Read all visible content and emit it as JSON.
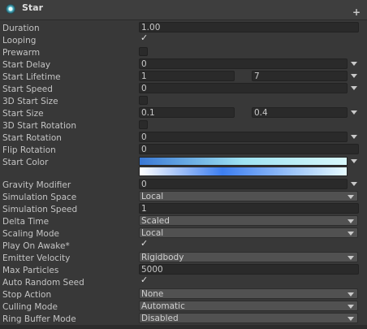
{
  "header": {
    "title": "Star",
    "icon": "particle-system-icon",
    "add_icon": "plus-icon",
    "add_label": "+"
  },
  "fields": {
    "duration": {
      "label": "Duration",
      "value": "1.00"
    },
    "looping": {
      "label": "Looping",
      "checked": true,
      "mark": "✓"
    },
    "prewarm": {
      "label": "Prewarm",
      "checked": false
    },
    "start_delay": {
      "label": "Start Delay",
      "value": "0"
    },
    "start_lifetime": {
      "label": "Start Lifetime",
      "min": "1",
      "max": "7"
    },
    "start_speed": {
      "label": "Start Speed",
      "value": "0"
    },
    "start_size_3d": {
      "label": "3D Start Size",
      "checked": false
    },
    "start_size": {
      "label": "Start Size",
      "min": "0.1",
      "max": "0.4"
    },
    "start_rotation_3d": {
      "label": "3D Start Rotation",
      "checked": false
    },
    "start_rotation": {
      "label": "Start Rotation",
      "value": "0"
    },
    "flip_rotation": {
      "label": "Flip Rotation",
      "value": "0"
    },
    "start_color": {
      "label": "Start Color",
      "gradient_top": [
        "#3a79d6",
        "#9fe3f2",
        "#d8f8fb"
      ],
      "gradient_bottom": [
        "#ffffff",
        "#3d7ef0",
        "#e6fbff"
      ]
    },
    "gravity_modifier": {
      "label": "Gravity Modifier",
      "value": "0"
    },
    "simulation_space": {
      "label": "Simulation Space",
      "value": "Local"
    },
    "simulation_speed": {
      "label": "Simulation Speed",
      "value": "1"
    },
    "delta_time": {
      "label": "Delta Time",
      "value": "Scaled"
    },
    "scaling_mode": {
      "label": "Scaling Mode",
      "value": "Local"
    },
    "play_on_awake": {
      "label": "Play On Awake*",
      "checked": true,
      "mark": "✓"
    },
    "emitter_velocity": {
      "label": "Emitter Velocity",
      "value": "Rigidbody"
    },
    "max_particles": {
      "label": "Max Particles",
      "value": "5000"
    },
    "auto_random_seed": {
      "label": "Auto Random Seed",
      "checked": true,
      "mark": "✓"
    },
    "stop_action": {
      "label": "Stop Action",
      "value": "None"
    },
    "culling_mode": {
      "label": "Culling Mode",
      "value": "Automatic"
    },
    "ring_buffer_mode": {
      "label": "Ring Buffer Mode",
      "value": "Disabled"
    }
  },
  "colors": {
    "panel_bg": "#383838",
    "field_bg": "#2a2a2a",
    "dropdown_bg": "#515151",
    "text": "#c4c4c4"
  }
}
